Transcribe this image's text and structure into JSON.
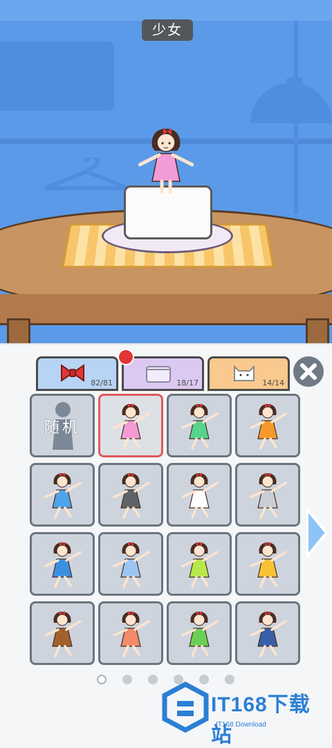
{
  "scene": {
    "character_name": "少女"
  },
  "tabs": [
    {
      "name": "bow-tab",
      "icon": "bow-icon",
      "count": "82/81",
      "color": "#b7d4f4"
    },
    {
      "name": "cube-tab",
      "icon": "box-icon",
      "count": "18/17",
      "color": "#dcc9f2"
    },
    {
      "name": "cat-tab",
      "icon": "cat-icon",
      "count": "14/14",
      "color": "#f9c98e"
    }
  ],
  "close_icon": "close-icon",
  "grid": {
    "random_label": "随机",
    "items": [
      {
        "name": "random",
        "dress": "#9aa6b3"
      },
      {
        "name": "pink-dress",
        "dress": "#f29bd6",
        "selected": true
      },
      {
        "name": "green-dress",
        "dress": "#57d38c"
      },
      {
        "name": "orange-dress",
        "dress": "#f59a2a"
      },
      {
        "name": "blue-dress",
        "dress": "#4fa3e8"
      },
      {
        "name": "gray-dress-glasses",
        "dress": "#5f6368"
      },
      {
        "name": "white-dress-hat",
        "dress": "#ffffff"
      },
      {
        "name": "plaid-dress",
        "dress": "#c9ced6"
      },
      {
        "name": "blue-dot-dress",
        "dress": "#3b8fe0"
      },
      {
        "name": "striped-dress",
        "dress": "#9cc5f2"
      },
      {
        "name": "leaf-dress",
        "dress": "#b6e84a"
      },
      {
        "name": "yellow-top",
        "dress": "#f5c333"
      },
      {
        "name": "brown-sweater",
        "dress": "#a0612c"
      },
      {
        "name": "apron-kettle",
        "dress": "#f08a6a"
      },
      {
        "name": "green-apron",
        "dress": "#6ccf55"
      },
      {
        "name": "chef",
        "dress": "#3a5fa8"
      }
    ]
  },
  "pager": {
    "total": 6,
    "active": 0
  },
  "watermark": {
    "text": "IT168下载站",
    "sub": "IT168 Download"
  }
}
